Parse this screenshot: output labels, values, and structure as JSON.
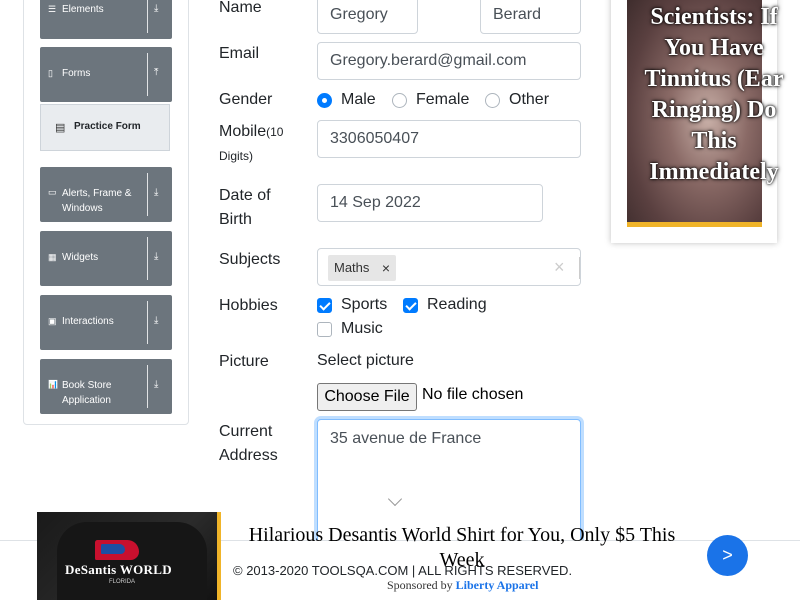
{
  "sidebar": {
    "groups": [
      {
        "label": "Elements",
        "icon": "list-icon",
        "glyph": "☰",
        "arrow": "⤓"
      },
      {
        "label": "Forms",
        "icon": "form-icon",
        "glyph": "▯",
        "arrow": "⤒"
      },
      {
        "label": "Alerts, Frame & Windows",
        "icon": "window-icon",
        "glyph": "▭",
        "arrow": "⤓"
      },
      {
        "label": "Widgets",
        "icon": "widgets-icon",
        "glyph": "▦",
        "arrow": "⤓"
      },
      {
        "label": "Interactions",
        "icon": "interactions-icon",
        "glyph": "▣",
        "arrow": "⤓"
      },
      {
        "label": "Book Store Application",
        "icon": "bookstore-icon",
        "glyph": "📊",
        "arrow": "⤓"
      }
    ],
    "active_item": {
      "label": "Practice Form",
      "icon": "practice-form-icon",
      "glyph": "▤"
    }
  },
  "form": {
    "name": {
      "label": "Name",
      "first_name": "Gregory",
      "last_name": "Berard"
    },
    "email": {
      "label": "Email",
      "value": "Gregory.berard@gmail.com"
    },
    "gender": {
      "label": "Gender",
      "options": [
        "Male",
        "Female",
        "Other"
      ],
      "selected": "Male"
    },
    "mobile": {
      "label": "Mobile",
      "hint": "(10 Digits)",
      "value": "3306050407"
    },
    "dob": {
      "label": "Date of Birth",
      "value": "14 Sep 2022"
    },
    "subjects": {
      "label": "Subjects",
      "chips": [
        "Maths"
      ],
      "remove_glyph": "×",
      "clear_glyph": "×"
    },
    "hobbies": {
      "label": "Hobbies",
      "options": [
        {
          "label": "Sports",
          "checked": true
        },
        {
          "label": "Reading",
          "checked": true
        },
        {
          "label": "Music",
          "checked": false
        }
      ]
    },
    "picture": {
      "label": "Picture",
      "select_label": "Select picture",
      "button": "Choose File",
      "status": "No file chosen"
    },
    "address": {
      "label": "Current Address",
      "value": "35 avenue de France"
    }
  },
  "side_ad": {
    "text": "Scientists: If You Have Tinnitus (Ear Ringing) Do This Immediately"
  },
  "footer": {
    "copyright": "© 2013-2020 TOOLSQA.COM | ALL RIGHTS RESERVED."
  },
  "banner_ad": {
    "title": "Hilarious Desantis World Shirt for You, Only $5 This Week",
    "sponsored_prefix": "Sponsored by",
    "sponsor": "Liberty Apparel",
    "logo": "DeSantis WORLD",
    "logo_sub": "FLORIDA",
    "next_glyph": ">"
  },
  "colors": {
    "primary": "#007bff",
    "sidebar_group": "#6c757d",
    "ad_blue": "#1a73e8"
  }
}
